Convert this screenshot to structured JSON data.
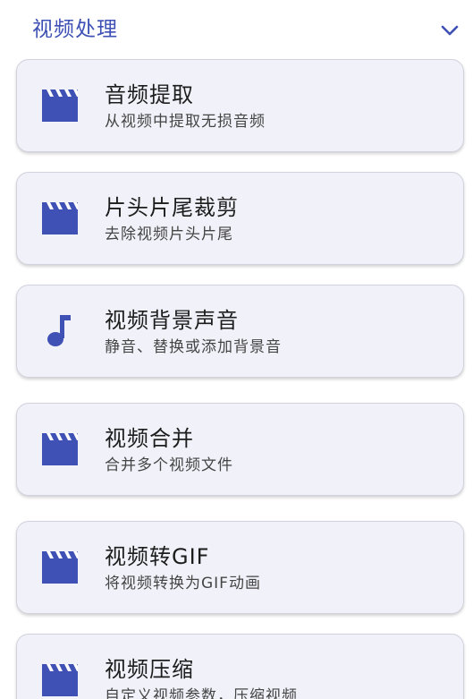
{
  "section": {
    "title": "视频处理",
    "collapse_icon": "chevron-down-icon"
  },
  "accent_color": "#3f51b5",
  "card_background": "#f1f1f9",
  "items": [
    {
      "title": "音频提取",
      "subtitle": "从视频中提取无损音频",
      "icon": "clapperboard-icon"
    },
    {
      "title": "片头片尾裁剪",
      "subtitle": "去除视频片头片尾",
      "icon": "clapperboard-icon"
    },
    {
      "title": "视频背景声音",
      "subtitle": "静音、替换或添加背景音",
      "icon": "music-note-icon"
    },
    {
      "title": "视频合并",
      "subtitle": "合并多个视频文件",
      "icon": "clapperboard-icon"
    },
    {
      "title": "视频转GIF",
      "subtitle": "将视频转换为GIF动画",
      "icon": "clapperboard-icon"
    },
    {
      "title": "视频压缩",
      "subtitle": "自定义视频参数，压缩视频",
      "icon": "clapperboard-icon"
    }
  ]
}
